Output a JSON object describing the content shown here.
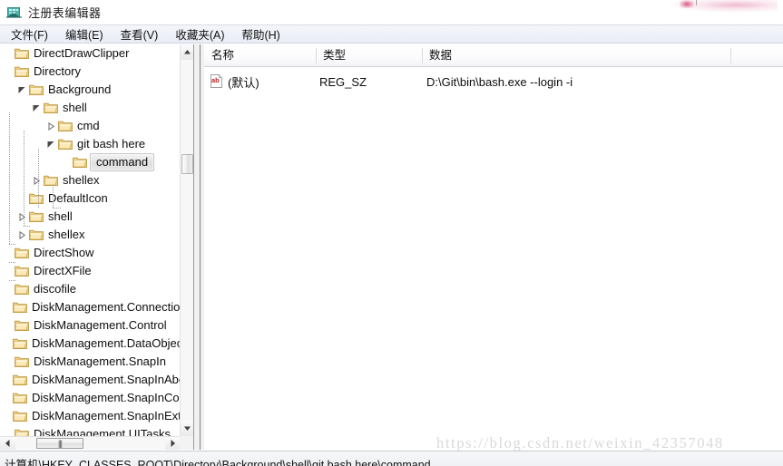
{
  "window": {
    "title": "注册表编辑器",
    "icon": "registry-editor-icon"
  },
  "menubar": {
    "items": [
      {
        "label": "文件(F)",
        "name": "menu-file"
      },
      {
        "label": "编辑(E)",
        "name": "menu-edit"
      },
      {
        "label": "查看(V)",
        "name": "menu-view"
      },
      {
        "label": "收藏夹(A)",
        "name": "menu-favorites"
      },
      {
        "label": "帮助(H)",
        "name": "menu-help"
      }
    ]
  },
  "tree": {
    "nodes": [
      {
        "label": "DirectDrawClipper",
        "depth": 0,
        "state": "leaf",
        "selected": false
      },
      {
        "label": "Directory",
        "depth": 0,
        "state": "leaf",
        "selected": false
      },
      {
        "label": "Background",
        "depth": 1,
        "state": "expanded",
        "selected": false
      },
      {
        "label": "shell",
        "depth": 2,
        "state": "expanded",
        "selected": false
      },
      {
        "label": "cmd",
        "depth": 3,
        "state": "collapsed",
        "selected": false
      },
      {
        "label": "git bash here",
        "depth": 3,
        "state": "expanded",
        "selected": false
      },
      {
        "label": "command",
        "depth": 4,
        "state": "leaf",
        "selected": true
      },
      {
        "label": "shellex",
        "depth": 2,
        "state": "collapsed",
        "selected": false
      },
      {
        "label": "DefaultIcon",
        "depth": 1,
        "state": "leaf",
        "selected": false
      },
      {
        "label": "shell",
        "depth": 1,
        "state": "collapsed",
        "selected": false
      },
      {
        "label": "shellex",
        "depth": 1,
        "state": "collapsed",
        "selected": false
      },
      {
        "label": "DirectShow",
        "depth": 0,
        "state": "leaf",
        "selected": false
      },
      {
        "label": "DirectXFile",
        "depth": 0,
        "state": "leaf",
        "selected": false
      },
      {
        "label": "discofile",
        "depth": 0,
        "state": "leaf",
        "selected": false
      },
      {
        "label": "DiskManagement.Connection",
        "depth": 0,
        "state": "leaf",
        "selected": false
      },
      {
        "label": "DiskManagement.Control",
        "depth": 0,
        "state": "leaf",
        "selected": false
      },
      {
        "label": "DiskManagement.DataObject",
        "depth": 0,
        "state": "leaf",
        "selected": false
      },
      {
        "label": "DiskManagement.SnapIn",
        "depth": 0,
        "state": "leaf",
        "selected": false
      },
      {
        "label": "DiskManagement.SnapInAbout",
        "depth": 0,
        "state": "leaf",
        "selected": false
      },
      {
        "label": "DiskManagement.SnapInComponent",
        "depth": 0,
        "state": "leaf",
        "selected": false
      },
      {
        "label": "DiskManagement.SnapInExtension",
        "depth": 0,
        "state": "leaf",
        "selected": false
      },
      {
        "label": "DiskManagement.UITasks",
        "depth": 0,
        "state": "leaf",
        "selected": false
      }
    ]
  },
  "values": {
    "columns": [
      {
        "label": "名称",
        "name": "column-name"
      },
      {
        "label": "类型",
        "name": "column-type"
      },
      {
        "label": "数据",
        "name": "column-data"
      }
    ],
    "rows": [
      {
        "icon": "string-value-icon",
        "name": "(默认)",
        "type": "REG_SZ",
        "data": "D:\\Git\\bin\\bash.exe --login -i"
      }
    ]
  },
  "statusbar": {
    "path": "计算机\\HKEY_CLASSES_ROOT\\Directory\\Background\\shell\\git bash here\\command"
  },
  "watermark": {
    "text": "https://blog.csdn.net/weixin_42357048"
  },
  "scrollbars": {
    "tree_vertical_thumb_label": "",
    "tree_horizontal_thumb_label": "|||"
  }
}
